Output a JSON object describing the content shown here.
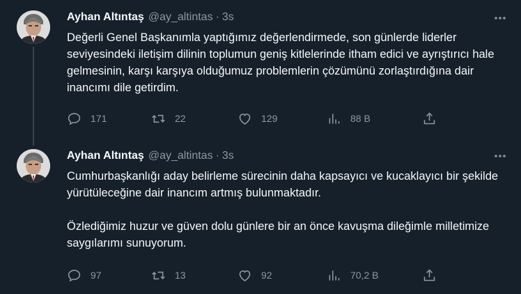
{
  "tweets": [
    {
      "author": {
        "name": "Ayhan Altıntaş",
        "handle": "@ay_altintas",
        "time": "3s",
        "avatar": "profile-photo"
      },
      "text": "Değerli Genel Başkanımla yaptığımız değerlendirmede, son günlerde liderler seviyesindeki iletişim dilinin toplumun geniş kitlelerinde itham edici ve ayrıştırıcı hale gelmesinin, karşı karşıya olduğumuz problemlerin çözümünü zorlaştırdığına dair inancımı dile getirdim.",
      "stats": {
        "replies": "171",
        "retweets": "22",
        "likes": "129",
        "views": "88 B"
      }
    },
    {
      "author": {
        "name": "Ayhan Altıntaş",
        "handle": "@ay_altintas",
        "time": "3s",
        "avatar": "profile-photo"
      },
      "text": "Cumhurbaşkanlığı aday belirleme sürecinin daha kapsayıcı ve kucaklayıcı bir şekilde yürütüleceğine dair inancım artmış bulunmaktadır.\n\nÖzlediğimiz huzur ve güven dolu günlere bir an önce kavuşma  dileğimle milletimize saygılarımı sunuyorum.",
      "stats": {
        "replies": "97",
        "retweets": "13",
        "likes": "92",
        "views": "70,2 B"
      }
    }
  ],
  "icons": {
    "more": "more-horizontal-icon",
    "reply": "reply-icon",
    "retweet": "retweet-icon",
    "like": "heart-icon",
    "views": "views-chart-icon",
    "share": "share-icon"
  },
  "colors": {
    "background": "#15202b",
    "text": "#f7f9f9",
    "secondary": "#8b98a5",
    "thread_line": "#38444d"
  }
}
